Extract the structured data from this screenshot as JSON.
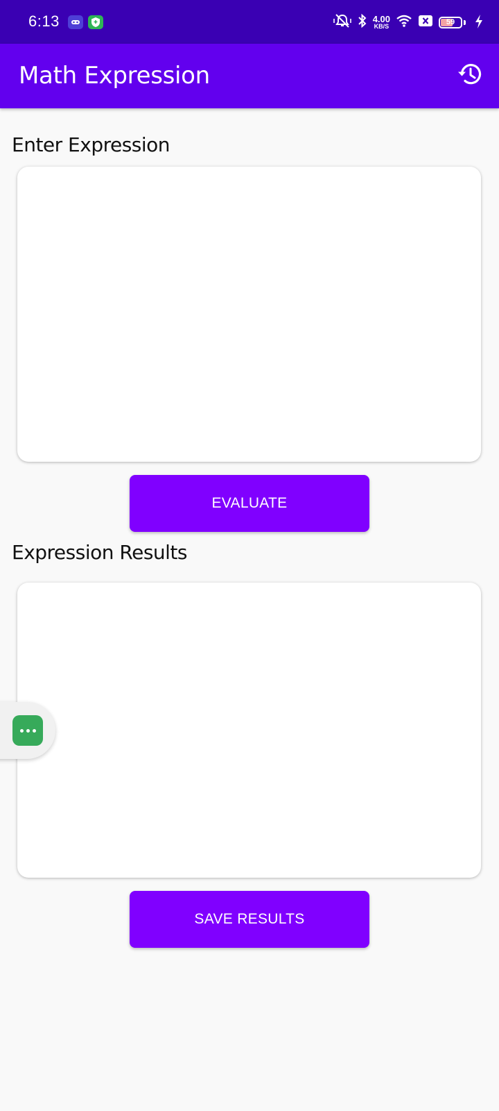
{
  "status_bar": {
    "time": "6:13",
    "net_speed_value": "4.00",
    "net_speed_unit": "KB/S",
    "battery_level": "59",
    "battery_fraction": 0.59,
    "icons": [
      "game-icon",
      "shield-icon",
      "mute-icon",
      "bluetooth-icon",
      "wifi-icon",
      "close-box-icon",
      "battery-icon",
      "charging-icon"
    ]
  },
  "app_bar": {
    "title": "Math Expression",
    "action_icon": "history-icon"
  },
  "input_section": {
    "label": "Enter Expression",
    "value": "",
    "button_label": "EVALUATE"
  },
  "results_section": {
    "label": "Expression Results",
    "value": "",
    "button_label": "SAVE RESULTS"
  },
  "floating_bubble": {
    "icon": "more-dots-icon"
  },
  "colors": {
    "status_bar": "#3a00b3",
    "app_bar": "#6200ee",
    "button": "#8000ff",
    "bubble": "#37aa5a",
    "background": "#f9f9f9"
  }
}
